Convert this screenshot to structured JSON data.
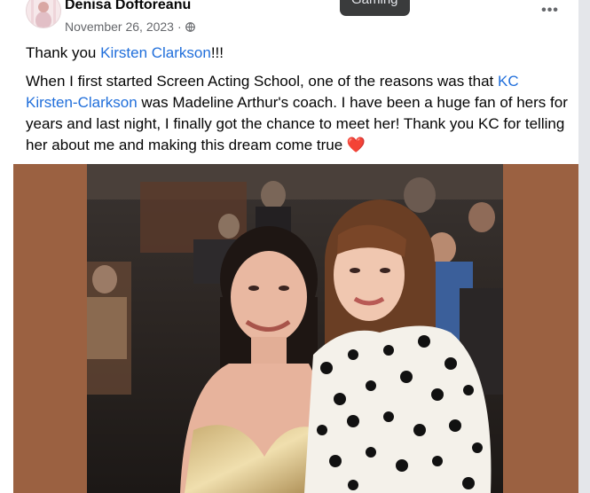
{
  "post": {
    "author": "Denisa Doftoreanu",
    "date": "November 26, 2023",
    "date_separator": "·",
    "more_label": "•••",
    "tooltip": "Gaming",
    "privacy_icon": "globe-icon",
    "avatar_icon": "profile-avatar"
  },
  "body": {
    "line1_prefix": "Thank you ",
    "line1_mention": "Kirsten Clarkson",
    "line1_suffix": "!!!",
    "para_prefix": "When I first started Screen Acting School, one of the reasons was that ",
    "para_mention1": "KC",
    "para_mention2": "Kirsten-Clarkson",
    "para_rest": " was Madeline Arthur's coach. I have been a huge fan of hers for years and last night, I finally got the chance to meet her! Thank you KC for telling her about me and making this dream come true ",
    "heart": "❤️"
  },
  "colors": {
    "link": "#216fdb",
    "photo_backdrop": "#9b6141",
    "tooltip_bg": "#3a3b3c"
  },
  "photo": {
    "description_icon": "post-photo"
  }
}
